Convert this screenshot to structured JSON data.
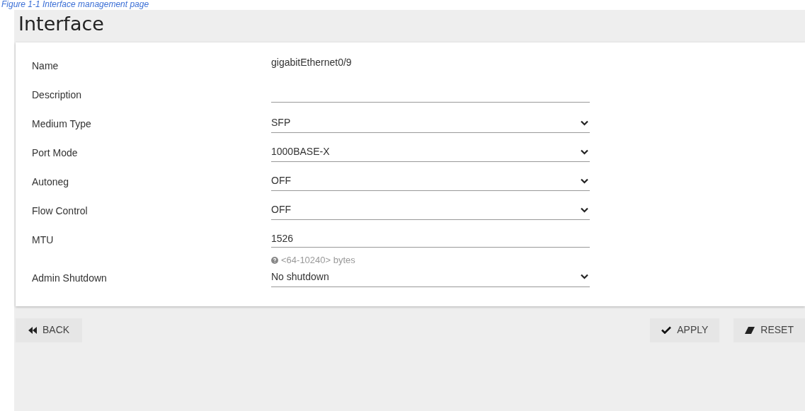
{
  "caption": "Figure 1-1 Interface management page",
  "title": "Interface",
  "fields": [
    {
      "label": "Name",
      "kind": "static",
      "value": "gigabitEthernet0/9"
    },
    {
      "label": "Description",
      "kind": "text"
    },
    {
      "label": "Medium Type",
      "kind": "select",
      "value": "SFP"
    },
    {
      "label": "Port Mode",
      "kind": "select",
      "value": "1000BASE-X"
    },
    {
      "label": "Autoneg",
      "kind": "select",
      "value": "OFF"
    },
    {
      "label": "Flow Control",
      "kind": "select",
      "value": "OFF"
    },
    {
      "label": "MTU",
      "kind": "text",
      "value": "1526",
      "hint": "<64-10240> bytes"
    },
    {
      "label": "Admin Shutdown",
      "kind": "select",
      "value": "No shutdown"
    }
  ],
  "buttons": {
    "back": "BACK",
    "apply": "APPLY",
    "reset": "RESET"
  }
}
